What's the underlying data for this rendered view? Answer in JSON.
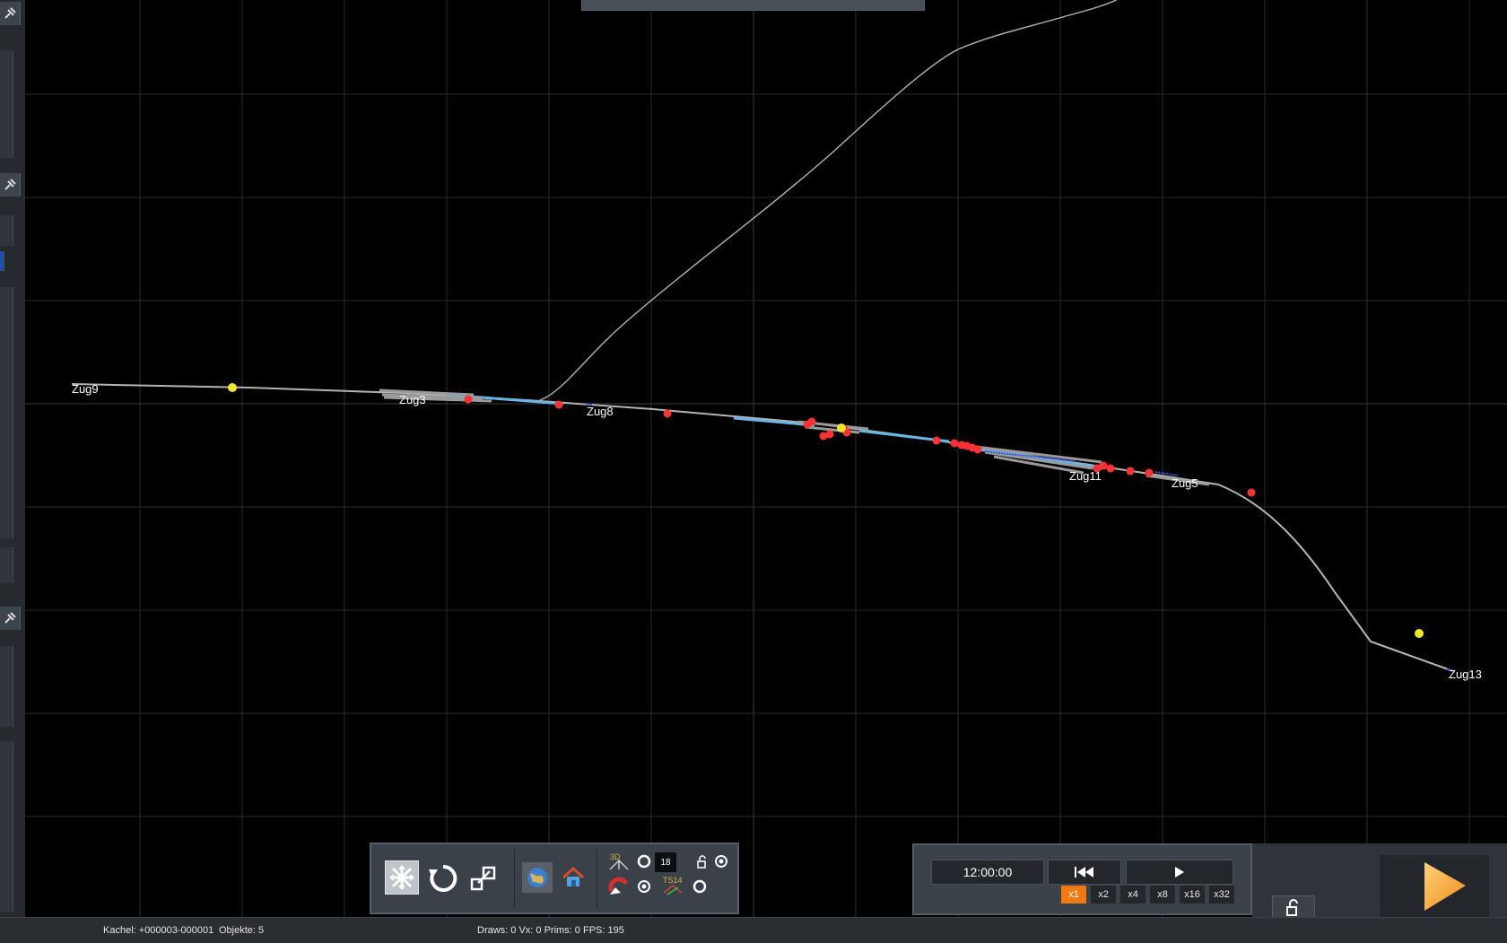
{
  "map": {
    "trains": [
      {
        "id": "zug9",
        "name": "Zug9"
      },
      {
        "id": "zug3",
        "name": "Zug3"
      },
      {
        "id": "zug8",
        "name": "Zug8"
      },
      {
        "id": "zug11",
        "name": "Zug11"
      },
      {
        "id": "zug5",
        "name": "Zug5"
      },
      {
        "id": "zug13",
        "name": "Zug13"
      }
    ],
    "colors": {
      "background": "#000000",
      "grid": "#2a2a2a",
      "track": "#b4b4b4",
      "track_highlight": "#6bb4e6",
      "signal_red": "#ff3333",
      "signal_yellow": "#f2e52a"
    }
  },
  "toolbar": {
    "icons": [
      "fit-view-icon",
      "rotate-reset-icon",
      "expand-icon",
      "globe-icon",
      "home-icon",
      "3d-view-icon",
      "magnet-icon",
      "ts-icon",
      "lock-small-icon"
    ],
    "layer_value": "18",
    "ts_label": "TS14",
    "view3d_label": "3D"
  },
  "time": {
    "clock": "12:00:00",
    "speeds": [
      "x1",
      "x2",
      "x4",
      "x8",
      "x16",
      "x32"
    ],
    "active_speed": "x1",
    "accent": "#f07a12"
  },
  "status": {
    "tile": "Kachel: +000003-000001",
    "objects": "Objekte: 5",
    "perf": "Draws: 0 Vx: 0 Prims: 0 FPS: 195"
  }
}
